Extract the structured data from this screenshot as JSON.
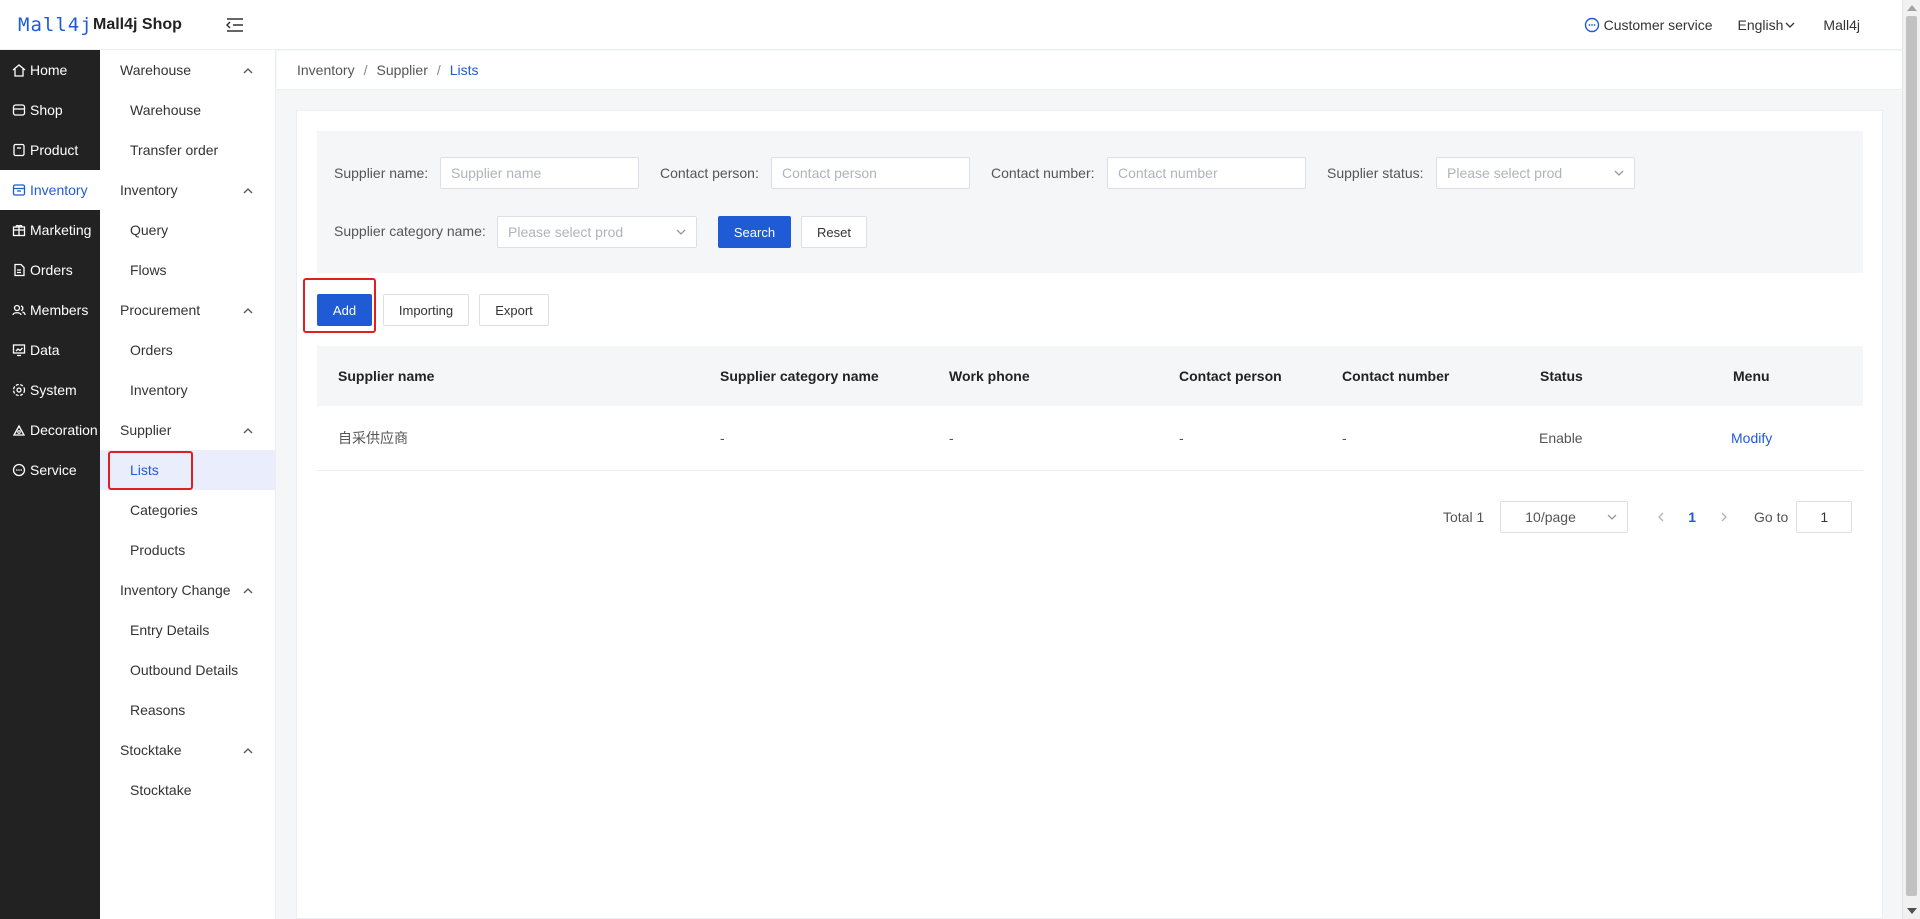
{
  "header": {
    "logo": "Mall4j",
    "shop_name": "Mall4j Shop",
    "customer_service": "Customer service",
    "language": "English",
    "user": "Mall4j"
  },
  "nav_primary": [
    {
      "label": "Home",
      "icon": "home-icon"
    },
    {
      "label": "Shop",
      "icon": "shop-icon"
    },
    {
      "label": "Product",
      "icon": "product-icon"
    },
    {
      "label": "Inventory",
      "icon": "inventory-icon"
    },
    {
      "label": "Marketing",
      "icon": "marketing-icon"
    },
    {
      "label": "Orders",
      "icon": "orders-icon"
    },
    {
      "label": "Members",
      "icon": "members-icon"
    },
    {
      "label": "Data",
      "icon": "data-icon"
    },
    {
      "label": "System",
      "icon": "system-icon"
    },
    {
      "label": "Decoration",
      "icon": "decoration-icon"
    },
    {
      "label": "Service",
      "icon": "service-icon"
    }
  ],
  "nav_secondary": {
    "warehouse": {
      "title": "Warehouse",
      "items": [
        "Warehouse",
        "Transfer order"
      ]
    },
    "inventory": {
      "title": "Inventory",
      "items": [
        "Query",
        "Flows"
      ]
    },
    "procurement": {
      "title": "Procurement",
      "items": [
        "Orders",
        "Inventory"
      ]
    },
    "supplier": {
      "title": "Supplier",
      "items": [
        "Lists",
        "Categories",
        "Products"
      ]
    },
    "inventory_change": {
      "title": "Inventory Change",
      "items": [
        "Entry Details",
        "Outbound Details",
        "Reasons"
      ]
    },
    "stocktake": {
      "title": "Stocktake",
      "items": [
        "Stocktake"
      ]
    }
  },
  "breadcrumb": [
    "Inventory",
    "Supplier",
    "Lists"
  ],
  "breadcrumb_sep": "/",
  "filter": {
    "supplier_name_label": "Supplier name:",
    "supplier_name_placeholder": "Supplier name",
    "contact_person_label": "Contact person:",
    "contact_person_placeholder": "Contact person",
    "contact_number_label": "Contact number:",
    "contact_number_placeholder": "Contact number",
    "status_label": "Supplier status:",
    "status_placeholder": "Please select prod",
    "category_label": "Supplier category name:",
    "category_placeholder": "Please select prod",
    "search": "Search",
    "reset": "Reset"
  },
  "actions": {
    "add": "Add",
    "importing": "Importing",
    "export": "Export"
  },
  "table": {
    "columns": [
      "Supplier name",
      "Supplier category name",
      "Work phone",
      "Contact person",
      "Contact number",
      "Status",
      "Menu"
    ],
    "rows": [
      {
        "supplier_name": "自采供应商",
        "category": "-",
        "work_phone": "-",
        "contact_person": "-",
        "contact_number": "-",
        "status": "Enable",
        "menu": "Modify"
      }
    ]
  },
  "pagination": {
    "total": "Total 1",
    "page_size": "10/page",
    "current_page": "1",
    "goto_label": "Go to",
    "goto_value": "1"
  },
  "colors": {
    "primary": "#1f5bd4",
    "sidebar": "#222222",
    "highlight": "#e02020"
  }
}
